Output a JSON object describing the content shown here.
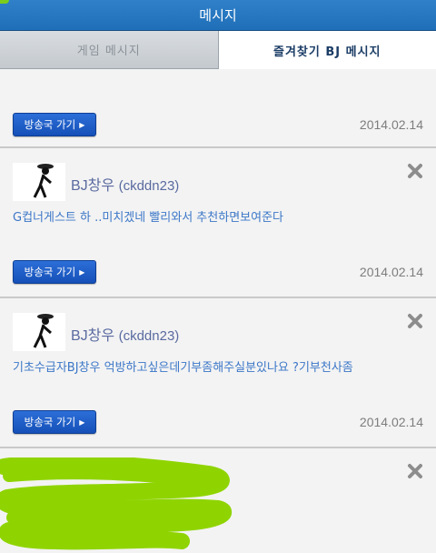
{
  "header": {
    "title": "메시지"
  },
  "tabs": [
    {
      "label": "게임 메시지",
      "active": false
    },
    {
      "label": "즐겨찾기 BJ 메시지",
      "active": true
    }
  ],
  "first_card": {
    "button_label": "방송국 가기",
    "date": "2014.02.14"
  },
  "messages": [
    {
      "user": "BJ창우",
      "user_id": "(ckddn23)",
      "text": "G컵너게스트 하 ..미치겠네 빨리와서 추천하면보여준다",
      "button_label": "방송국 가기",
      "date": "2014.02.14"
    },
    {
      "user": "BJ창우",
      "user_id": "(ckddn23)",
      "text": "기초수급자BJ창우 억방하고싶은데기부좀해주실분있나요 ?기부천사좀",
      "button_label": "방송국 가기",
      "date": "2014.02.14"
    }
  ],
  "colors": {
    "accent": "#1f6fb8",
    "button": "#1a5cc8",
    "message_text": "#3c77c8",
    "redaction": "#8fd400"
  }
}
